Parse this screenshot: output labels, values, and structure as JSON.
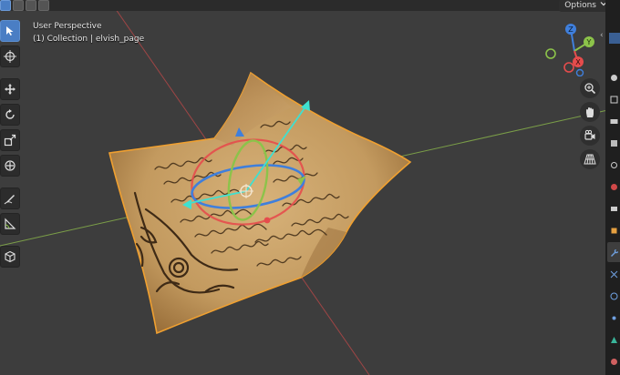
{
  "viewport": {
    "view_name": "User Perspective",
    "collection_line": "(1) Collection | elvish_page"
  },
  "header": {
    "options_label": "Options",
    "options_icon": "chevron-down-icon"
  },
  "toolbar": {
    "tools": [
      "select-cursor-icon",
      "cursor-target-icon",
      "move-icon",
      "rotate-icon",
      "scale-icon",
      "transform-icon",
      "annotate-icon",
      "measure-icon",
      "add-cube-icon"
    ],
    "active_tool": "select-cursor-icon"
  },
  "navigation": {
    "gizmo_axes": [
      "Z",
      "Y",
      "X"
    ],
    "buttons": [
      "zoom-icon",
      "hand-pan-icon",
      "camera-icon",
      "grid-perspective-icon"
    ]
  },
  "colors": {
    "accent": "#4a7ec4",
    "axis_x": "#e54c4c",
    "axis_y": "#8cc34a",
    "axis_z": "#3f7fdc",
    "selection_outline": "#f0a030",
    "gizmo_cyan": "#3fe0d0"
  }
}
